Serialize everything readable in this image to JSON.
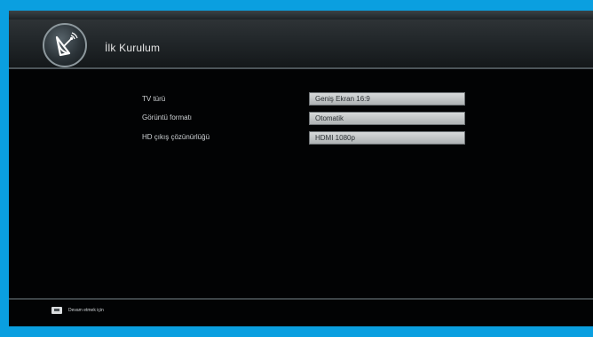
{
  "header": {
    "title": "İlk Kurulum",
    "logo_icon": "satellite-dish-icon"
  },
  "settings": [
    {
      "label": "TV türü",
      "value": "Geniş Ekran 16:9"
    },
    {
      "label": "Görüntü formatı",
      "value": "Otomatik"
    },
    {
      "label": "HD çıkış çözünürlüğü",
      "value": "HDMI 1080p"
    }
  ],
  "footer": {
    "icon": "remote-key-icon",
    "hint": "Devam etmek için"
  },
  "colors": {
    "frame": "#0a9fe0",
    "background": "#020304",
    "header": "#2e3336",
    "value_box": "#d7d9da"
  }
}
